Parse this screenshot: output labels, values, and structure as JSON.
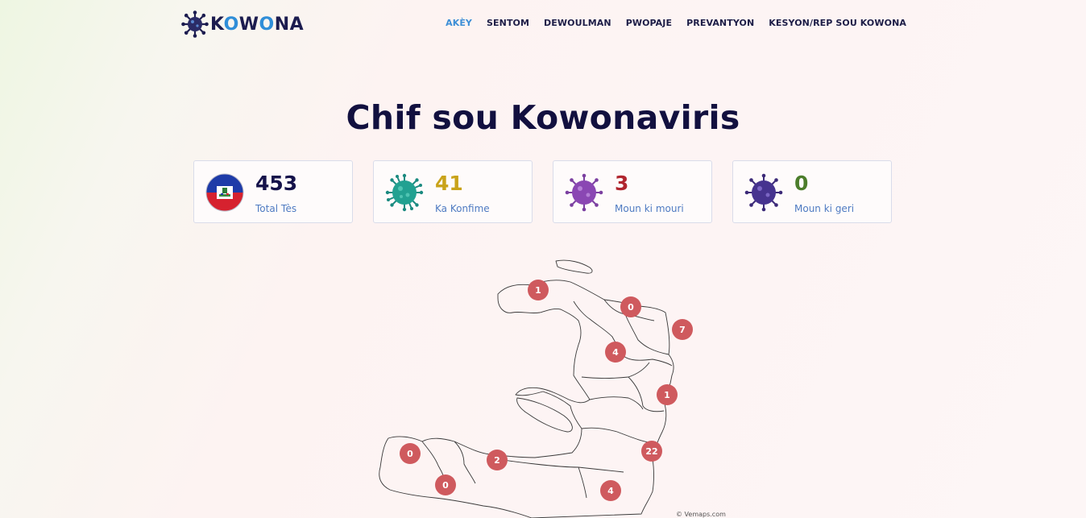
{
  "header": {
    "logo": {
      "prefix": "K",
      "o1": "O",
      "mid": "W",
      "o2": "O",
      "suffix": "NA",
      "icon": "virus-icon"
    },
    "nav": [
      "AKÈY",
      "SENTOM",
      "DEWOULMAN",
      "PWOPAJE",
      "PREVANTYON",
      "KESYON/REP SOU KOWONA"
    ],
    "active_nav": "AKÈY"
  },
  "title": "Chif sou Kowonaviris",
  "stats": [
    {
      "value": "453",
      "label": "Total Tès",
      "icon": "haiti-flag-icon",
      "color": "#15124a"
    },
    {
      "value": "41",
      "label": "Ka Konfime",
      "icon": "green-virus-icon",
      "color": "#c9a31a"
    },
    {
      "value": "3",
      "label": "Moun ki mouri",
      "icon": "purple-virus-icon",
      "color": "#b1262f"
    },
    {
      "value": "0",
      "label": "Moun ki geri",
      "icon": "dark-purple-virus-icon",
      "color": "#4c7d2b"
    }
  ],
  "map": {
    "markers": [
      "1",
      "0",
      "7",
      "4",
      "1",
      "22",
      "0",
      "2",
      "0",
      "4"
    ],
    "credit": "© Vemaps.com",
    "marker_color": "#cf5a5e"
  }
}
